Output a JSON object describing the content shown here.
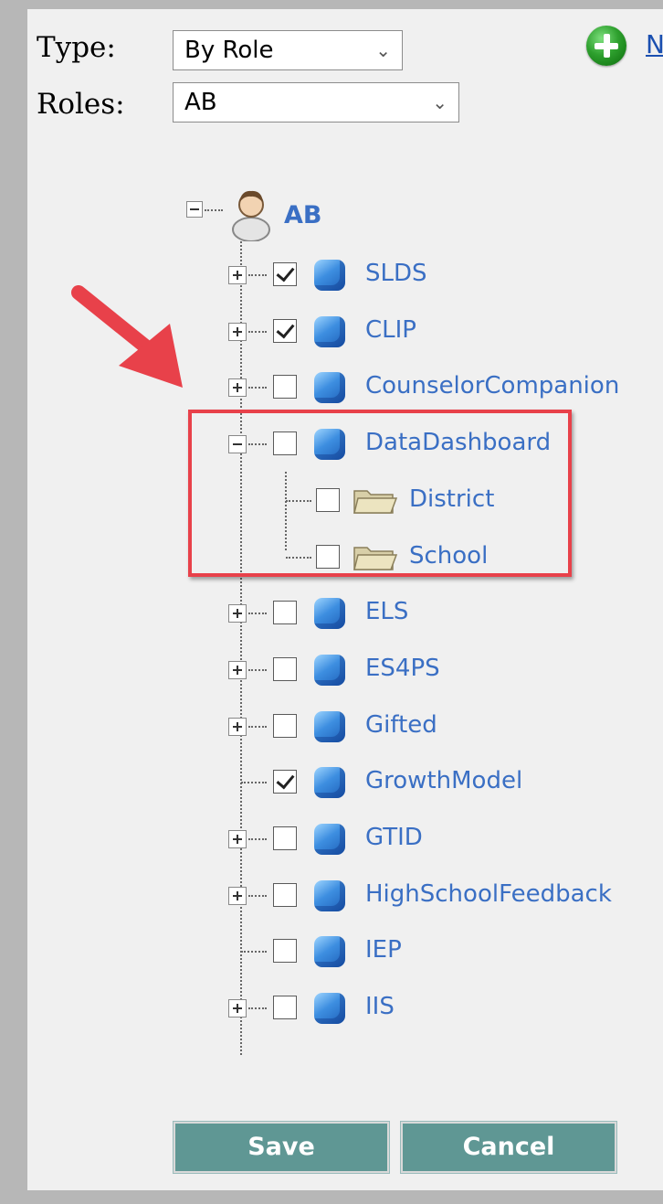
{
  "type_label": "Type:",
  "type_value": "By Role",
  "roles_label": "Roles:",
  "roles_value": "AB",
  "partial_link": "N",
  "tree": {
    "root": "AB",
    "nodes": [
      {
        "label": "SLDS",
        "checked": true,
        "expander": "plus"
      },
      {
        "label": "CLIP",
        "checked": true,
        "expander": "plus"
      },
      {
        "label": "CounselorCompanion",
        "checked": false,
        "expander": "plus"
      },
      {
        "label": "DataDashboard",
        "checked": false,
        "expander": "minus"
      },
      {
        "label": "District",
        "checked": false,
        "expander": "none",
        "child": true
      },
      {
        "label": "School",
        "checked": false,
        "expander": "none",
        "child": true
      },
      {
        "label": "ELS",
        "checked": false,
        "expander": "plus"
      },
      {
        "label": "ES4PS",
        "checked": false,
        "expander": "plus"
      },
      {
        "label": "Gifted",
        "checked": false,
        "expander": "plus"
      },
      {
        "label": "GrowthModel",
        "checked": true,
        "expander": "none"
      },
      {
        "label": "GTID",
        "checked": false,
        "expander": "plus"
      },
      {
        "label": "HighSchoolFeedback",
        "checked": false,
        "expander": "plus"
      },
      {
        "label": "IEP",
        "checked": false,
        "expander": "none"
      },
      {
        "label": "IIS",
        "checked": false,
        "expander": "plus"
      }
    ]
  },
  "buttons": {
    "save": "Save",
    "cancel": "Cancel"
  },
  "colors": {
    "link": "#3a6fc4",
    "highlight": "#e8414a",
    "button": "#5f9794"
  }
}
